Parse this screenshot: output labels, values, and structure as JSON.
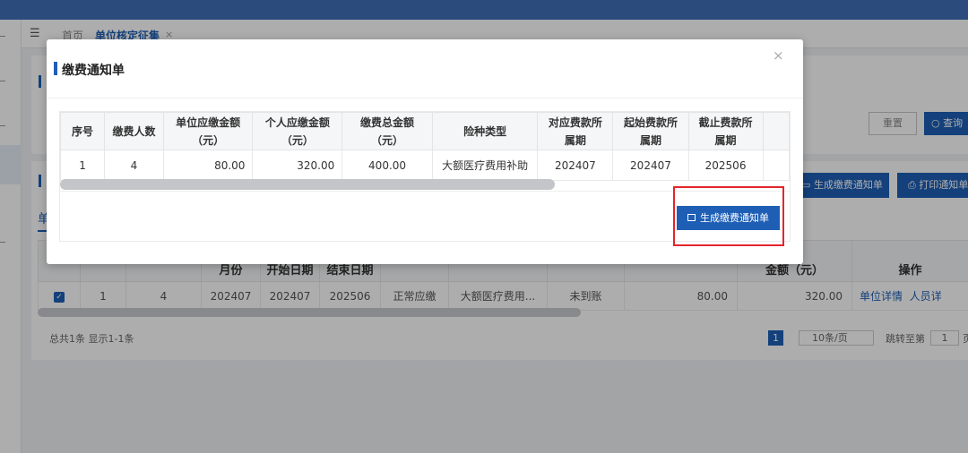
{
  "tabs": {
    "home": "首页",
    "active": "单位核定征集",
    "close": "×"
  },
  "background": {
    "buttons": {
      "reset": "重置",
      "query": "查询",
      "generate": "生成缴费通知单",
      "print": "打印通知单"
    },
    "sub_tab": "单",
    "table": {
      "headers": [
        "",
        "",
        "",
        "月份",
        "开始日期",
        "结束日期",
        "",
        "",
        "",
        "",
        "金额（元）",
        "操作"
      ],
      "row": {
        "checked": "✓",
        "seq": "1",
        "count": "4",
        "month": "202407",
        "start": "202407",
        "end": "202506",
        "status": "正常应缴",
        "insurance": "大额医疗费用...",
        "account": "未到账",
        "unit_amount": "80.00",
        "personal_amount": "320.00",
        "op_unit": "单位详情",
        "op_person": "人员详"
      }
    },
    "footer": {
      "summary": "总共1条 显示1-1条",
      "page": "1",
      "page_size": "10条/页",
      "jump_label": "跳转至第",
      "jump_value": "1",
      "jump_unit": "页"
    }
  },
  "modal": {
    "title": "缴费通知单",
    "close": "×",
    "table": {
      "headers": [
        [
          "序号"
        ],
        [
          "缴费人数"
        ],
        [
          "单位应缴金额",
          "（元）"
        ],
        [
          "个人应缴金额",
          "（元）"
        ],
        [
          "缴费总金额",
          "（元）"
        ],
        [
          "险种类型"
        ],
        [
          "对应费款所",
          "属期"
        ],
        [
          "起始费款所",
          "属期"
        ],
        [
          "截止费款所",
          "属期"
        ]
      ],
      "rows": [
        {
          "seq": "1",
          "count": "4",
          "unit_amount": "80.00",
          "personal_amount": "320.00",
          "total_amount": "400.00",
          "insurance_type": "大额医疗费用补助",
          "period": "202407",
          "start_period": "202407",
          "end_period": "202506"
        }
      ]
    },
    "generate_button": "生成缴费通知单"
  }
}
